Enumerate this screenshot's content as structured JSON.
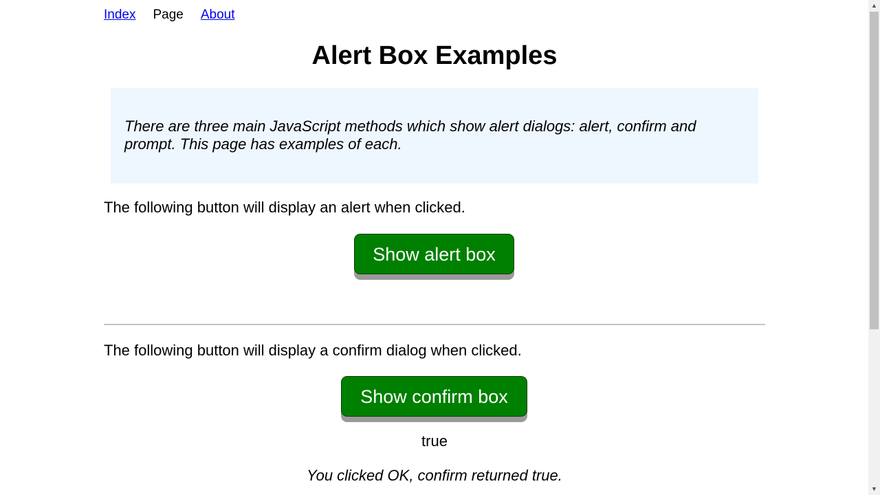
{
  "nav": {
    "links": [
      {
        "label": "Index"
      },
      {
        "label": "Page"
      },
      {
        "label": "About"
      }
    ]
  },
  "page": {
    "title": "Alert Box Examples",
    "intro": "There are three main JavaScript methods which show alert dialogs: alert, confirm and prompt. This page has examples of each."
  },
  "alert_section": {
    "description": "The following button will display an alert when clicked.",
    "button_label": "Show alert box"
  },
  "confirm_section": {
    "description": "The following button will display a confirm dialog when clicked.",
    "button_label": "Show confirm box",
    "return_value": "true",
    "explanation": "You clicked OK, confirm returned true."
  },
  "colors": {
    "button_green": "#008000",
    "intro_background": "#eef7ff",
    "link_blue": "#0000ee"
  },
  "icons": {
    "scroll_up": "scroll-up-arrow-icon",
    "scroll_down": "scroll-down-arrow-icon"
  },
  "scrollbar_arrows": {
    "up": "▲",
    "down": "▼"
  }
}
